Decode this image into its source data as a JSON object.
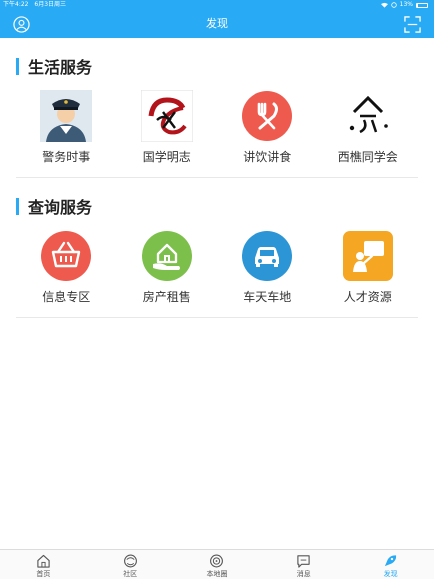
{
  "statusbar": {
    "time": "下午4:22",
    "date": "6月3日周三",
    "battery": "13%"
  },
  "navbar": {
    "title": "发现"
  },
  "sections": [
    {
      "title": "生活服务",
      "items": [
        {
          "label": "警务时事",
          "icon": "police-officer-icon"
        },
        {
          "label": "国学明志",
          "icon": "dragon-calligraphy-icon"
        },
        {
          "label": "讲饮讲食",
          "icon": "fork-knife-icon"
        },
        {
          "label": "西樵同学会",
          "icon": "alumni-calligraphy-icon"
        }
      ]
    },
    {
      "title": "查询服务",
      "items": [
        {
          "label": "信息专区",
          "icon": "basket-icon"
        },
        {
          "label": "房产租售",
          "icon": "house-hand-icon"
        },
        {
          "label": "车天车地",
          "icon": "car-icon"
        },
        {
          "label": "人才资源",
          "icon": "person-board-icon"
        }
      ]
    }
  ],
  "tabbar": {
    "items": [
      {
        "label": "首页",
        "icon": "home-icon"
      },
      {
        "label": "社区",
        "icon": "community-icon"
      },
      {
        "label": "本地圈",
        "icon": "local-circle-icon"
      },
      {
        "label": "消息",
        "icon": "message-icon"
      },
      {
        "label": "发现",
        "icon": "discover-icon"
      }
    ],
    "active": "发现"
  },
  "colors": {
    "accent": "#29aaf4",
    "red": "#ef5a4e",
    "green": "#7cc04b",
    "orange": "#f5a623"
  }
}
